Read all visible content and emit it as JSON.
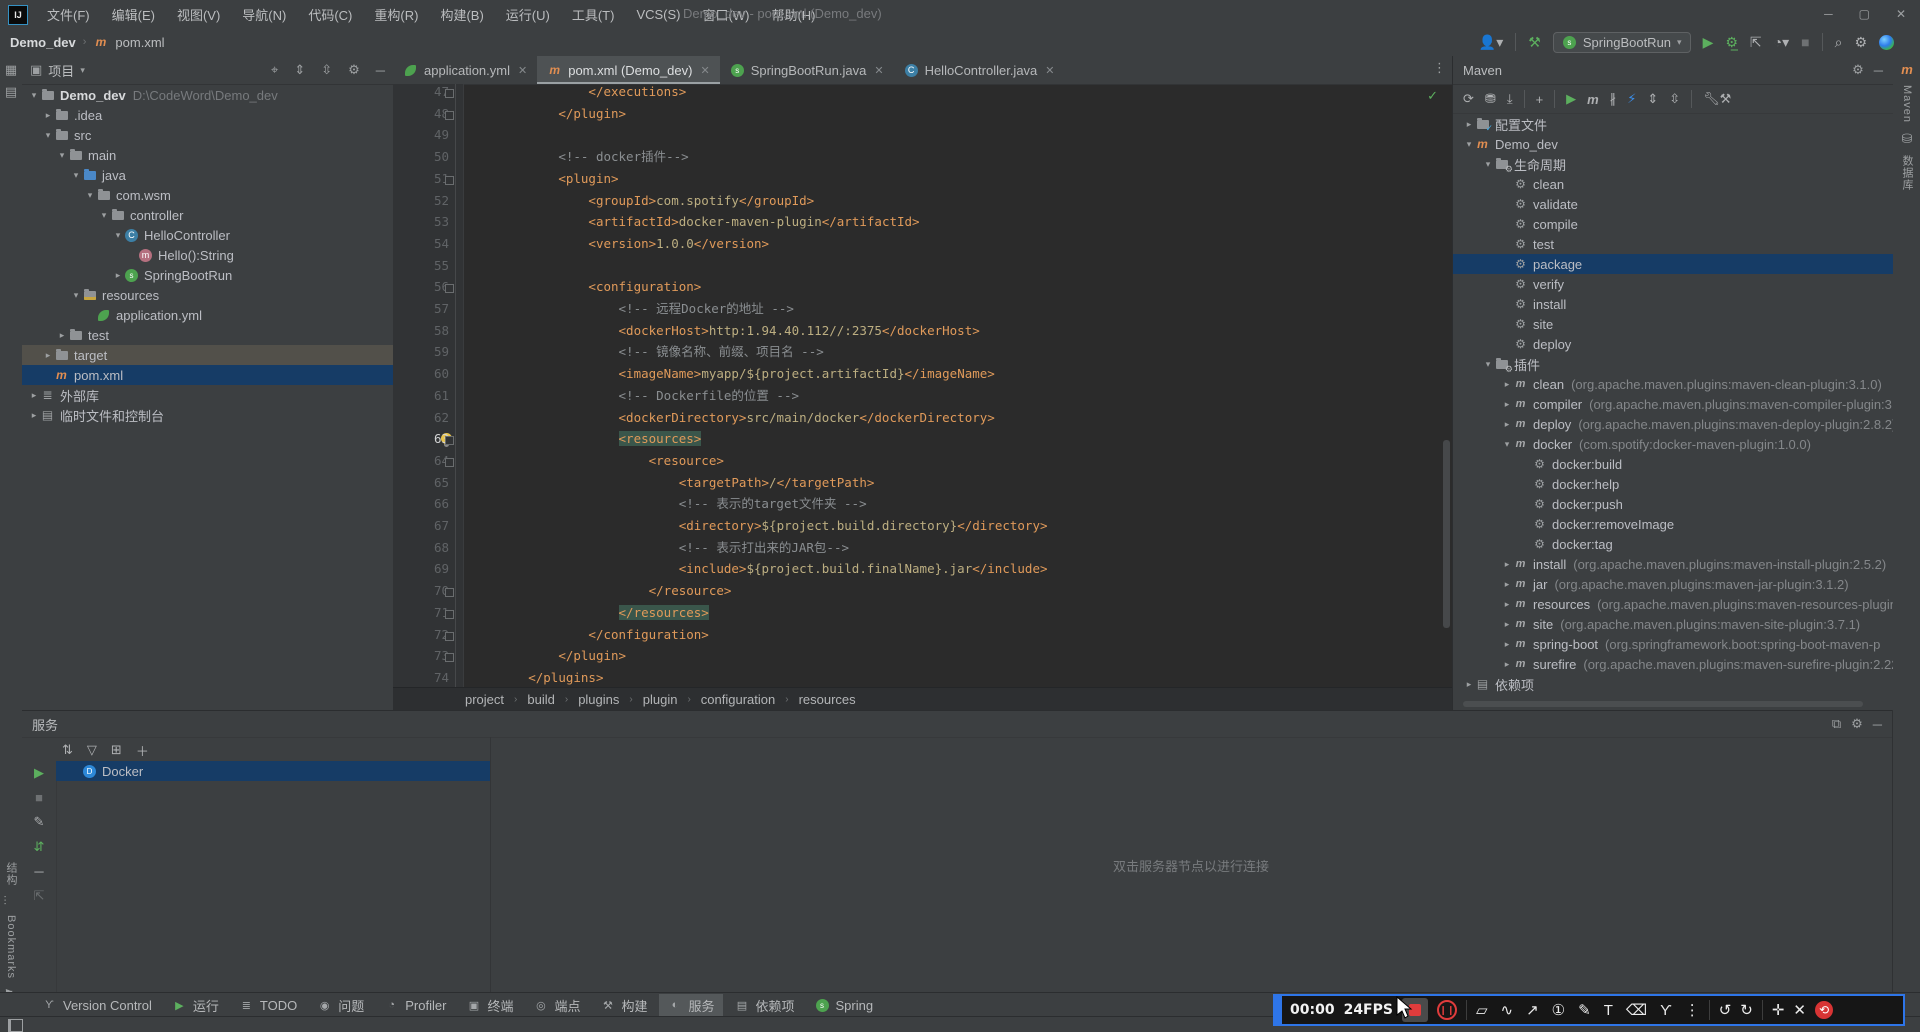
{
  "window": {
    "logo": "IJ",
    "title": "Demo_dev - pom.xml (Demo_dev)",
    "menus": [
      "文件(F)",
      "编辑(E)",
      "视图(V)",
      "导航(N)",
      "代码(C)",
      "重构(R)",
      "构建(B)",
      "运行(U)",
      "工具(T)",
      "VCS(S)",
      "窗口(W)",
      "帮助(H)"
    ],
    "controls": [
      "─",
      "▢",
      "✕"
    ]
  },
  "navbar": {
    "breadcrumb": [
      "Demo_dev",
      "pom.xml"
    ],
    "run_config": "SpringBootRun"
  },
  "tabs": [
    {
      "label": "application.yml",
      "icon": "yml",
      "active": false
    },
    {
      "label": "pom.xml (Demo_dev)",
      "icon": "m",
      "active": true
    },
    {
      "label": "SpringBootRun.java",
      "icon": "spring",
      "active": false
    },
    {
      "label": "HelloController.java",
      "icon": "class",
      "active": false
    }
  ],
  "project": {
    "title": "项目",
    "tree": [
      {
        "d": 0,
        "chev": "v",
        "icon": "folder",
        "label": "Demo_dev",
        "bold": true,
        "extra": "D:\\CodeWord\\Demo_dev",
        "sel": ""
      },
      {
        "d": 1,
        "chev": ">",
        "icon": "folder",
        "label": ".idea",
        "sel": ""
      },
      {
        "d": 1,
        "chev": "v",
        "icon": "folder",
        "label": "src",
        "sel": ""
      },
      {
        "d": 2,
        "chev": "v",
        "icon": "folder",
        "label": "main",
        "sel": ""
      },
      {
        "d": 3,
        "chev": "v",
        "icon": "folder-blue",
        "label": "java",
        "sel": ""
      },
      {
        "d": 4,
        "chev": "v",
        "icon": "folder",
        "label": "com.wsm",
        "sel": ""
      },
      {
        "d": 5,
        "chev": "v",
        "icon": "folder",
        "label": "controller",
        "sel": ""
      },
      {
        "d": 6,
        "chev": "v",
        "icon": "class",
        "label": "HelloController",
        "sel": ""
      },
      {
        "d": 7,
        "chev": "",
        "icon": "method",
        "label": "Hello():String",
        "sel": ""
      },
      {
        "d": 6,
        "chev": ">",
        "icon": "spring",
        "label": "SpringBootRun",
        "sel": ""
      },
      {
        "d": 3,
        "chev": "v",
        "icon": "folder-res",
        "label": "resources",
        "sel": ""
      },
      {
        "d": 4,
        "chev": "",
        "icon": "yml",
        "label": "application.yml",
        "sel": ""
      },
      {
        "d": 2,
        "chev": ">",
        "icon": "folder",
        "label": "test",
        "sel": ""
      },
      {
        "d": 1,
        "chev": ">",
        "icon": "folder",
        "label": "target",
        "sel": "gray"
      },
      {
        "d": 1,
        "chev": "",
        "icon": "m",
        "label": "pom.xml",
        "sel": "blue"
      },
      {
        "d": 0,
        "chev": ">",
        "icon": "lib",
        "label": "外部库",
        "sel": ""
      },
      {
        "d": 0,
        "chev": ">",
        "icon": "console",
        "label": "临时文件和控制台",
        "sel": ""
      }
    ]
  },
  "editor": {
    "current_line": 63,
    "fold_lines": [
      47,
      48,
      51,
      56,
      63,
      64,
      70,
      71,
      72,
      73
    ],
    "lines": [
      {
        "n": 47,
        "t": "                </executions>"
      },
      {
        "n": 48,
        "t": "            </plugin>"
      },
      {
        "n": 49,
        "t": ""
      },
      {
        "n": 50,
        "t": "            <!-- docker插件-->"
      },
      {
        "n": 51,
        "t": "            <plugin>"
      },
      {
        "n": 52,
        "t": "                <groupId>com.spotify</groupId>"
      },
      {
        "n": 53,
        "t": "                <artifactId>docker-maven-plugin</artifactId>"
      },
      {
        "n": 54,
        "t": "                <version>1.0.0</version>"
      },
      {
        "n": 55,
        "t": ""
      },
      {
        "n": 56,
        "t": "                <configuration>"
      },
      {
        "n": 57,
        "t": "                    <!-- 远程Docker的地址 -->"
      },
      {
        "n": 58,
        "t": "                    <dockerHost>http:1.94.40.112//:2375</dockerHost>"
      },
      {
        "n": 59,
        "t": "                    <!-- 镜像名称、前缀、项目名 -->"
      },
      {
        "n": 60,
        "t": "                    <imageName>myapp/${project.artifactId}</imageName>"
      },
      {
        "n": 61,
        "t": "                    <!-- Dockerfile的位置 -->"
      },
      {
        "n": 62,
        "t": "                    <dockerDirectory>src/main/docker</dockerDirectory>"
      },
      {
        "n": 63,
        "t": "                    <resources>",
        "hl": true
      },
      {
        "n": 64,
        "t": "                        <resource>"
      },
      {
        "n": 65,
        "t": "                            <targetPath>/</targetPath>"
      },
      {
        "n": 66,
        "t": "                            <!-- 表示的target文件夹 -->"
      },
      {
        "n": 67,
        "t": "                            <directory>${project.build.directory}</directory>"
      },
      {
        "n": 68,
        "t": "                            <!-- 表示打出来的JAR包-->"
      },
      {
        "n": 69,
        "t": "                            <include>${project.build.finalName}.jar</include>"
      },
      {
        "n": 70,
        "t": "                        </resource>"
      },
      {
        "n": 71,
        "t": "                    </resources>",
        "hl": true
      },
      {
        "n": 72,
        "t": "                </configuration>"
      },
      {
        "n": 73,
        "t": "            </plugin>"
      },
      {
        "n": 74,
        "t": "        </plugins>"
      }
    ],
    "breadcrumbs": [
      "project",
      "build",
      "plugins",
      "plugin",
      "configuration",
      "resources"
    ]
  },
  "maven": {
    "title": "Maven",
    "tree": [
      {
        "d": 0,
        "chev": ">",
        "icon": "folder-check",
        "label": "配置文件",
        "extra": "",
        "sel": ""
      },
      {
        "d": 0,
        "chev": "v",
        "icon": "m",
        "label": "Demo_dev",
        "extra": "",
        "sel": ""
      },
      {
        "d": 1,
        "chev": "v",
        "icon": "folder-gear",
        "label": "生命周期",
        "extra": "",
        "sel": ""
      },
      {
        "d": 2,
        "chev": "",
        "icon": "goal",
        "label": "clean",
        "extra": "",
        "sel": ""
      },
      {
        "d": 2,
        "chev": "",
        "icon": "goal",
        "label": "validate",
        "extra": "",
        "sel": ""
      },
      {
        "d": 2,
        "chev": "",
        "icon": "goal",
        "label": "compile",
        "extra": "",
        "sel": ""
      },
      {
        "d": 2,
        "chev": "",
        "icon": "goal",
        "label": "test",
        "extra": "",
        "sel": ""
      },
      {
        "d": 2,
        "chev": "",
        "icon": "goal",
        "label": "package",
        "extra": "",
        "sel": "blue"
      },
      {
        "d": 2,
        "chev": "",
        "icon": "goal",
        "label": "verify",
        "extra": "",
        "sel": ""
      },
      {
        "d": 2,
        "chev": "",
        "icon": "goal",
        "label": "install",
        "extra": "",
        "sel": ""
      },
      {
        "d": 2,
        "chev": "",
        "icon": "goal",
        "label": "site",
        "extra": "",
        "sel": ""
      },
      {
        "d": 2,
        "chev": "",
        "icon": "goal",
        "label": "deploy",
        "extra": "",
        "sel": ""
      },
      {
        "d": 1,
        "chev": "v",
        "icon": "folder-gear",
        "label": "插件",
        "extra": "",
        "sel": ""
      },
      {
        "d": 2,
        "chev": ">",
        "icon": "mgray",
        "label": "clean",
        "extra": "(org.apache.maven.plugins:maven-clean-plugin:3.1.0)",
        "sel": ""
      },
      {
        "d": 2,
        "chev": ">",
        "icon": "mgray",
        "label": "compiler",
        "extra": "(org.apache.maven.plugins:maven-compiler-plugin:3.",
        "sel": ""
      },
      {
        "d": 2,
        "chev": ">",
        "icon": "mgray",
        "label": "deploy",
        "extra": "(org.apache.maven.plugins:maven-deploy-plugin:2.8.2)",
        "sel": ""
      },
      {
        "d": 2,
        "chev": "v",
        "icon": "mgray",
        "label": "docker",
        "extra": "(com.spotify:docker-maven-plugin:1.0.0)",
        "sel": ""
      },
      {
        "d": 3,
        "chev": "",
        "icon": "goal",
        "label": "docker:build",
        "extra": "",
        "sel": ""
      },
      {
        "d": 3,
        "chev": "",
        "icon": "goal",
        "label": "docker:help",
        "extra": "",
        "sel": ""
      },
      {
        "d": 3,
        "chev": "",
        "icon": "goal",
        "label": "docker:push",
        "extra": "",
        "sel": ""
      },
      {
        "d": 3,
        "chev": "",
        "icon": "goal",
        "label": "docker:removeImage",
        "extra": "",
        "sel": ""
      },
      {
        "d": 3,
        "chev": "",
        "icon": "goal",
        "label": "docker:tag",
        "extra": "",
        "sel": ""
      },
      {
        "d": 2,
        "chev": ">",
        "icon": "mgray",
        "label": "install",
        "extra": "(org.apache.maven.plugins:maven-install-plugin:2.5.2)",
        "sel": ""
      },
      {
        "d": 2,
        "chev": ">",
        "icon": "mgray",
        "label": "jar",
        "extra": "(org.apache.maven.plugins:maven-jar-plugin:3.1.2)",
        "sel": ""
      },
      {
        "d": 2,
        "chev": ">",
        "icon": "mgray",
        "label": "resources",
        "extra": "(org.apache.maven.plugins:maven-resources-plugin:",
        "sel": ""
      },
      {
        "d": 2,
        "chev": ">",
        "icon": "mgray",
        "label": "site",
        "extra": "(org.apache.maven.plugins:maven-site-plugin:3.7.1)",
        "sel": ""
      },
      {
        "d": 2,
        "chev": ">",
        "icon": "mgray",
        "label": "spring-boot",
        "extra": "(org.springframework.boot:spring-boot-maven-p",
        "sel": ""
      },
      {
        "d": 2,
        "chev": ">",
        "icon": "mgray",
        "label": "surefire",
        "extra": "(org.apache.maven.plugins:maven-surefire-plugin:2.22",
        "sel": ""
      },
      {
        "d": 0,
        "chev": ">",
        "icon": "deps",
        "label": "依赖项",
        "extra": "",
        "sel": ""
      }
    ]
  },
  "services": {
    "title": "服务",
    "rows": [
      {
        "icon": "docker",
        "label": "Docker",
        "sel": "blue"
      }
    ],
    "hint": "双击服务器节点以进行连接"
  },
  "bottombar": [
    {
      "icon": "branch",
      "label": "Version Control",
      "active": false
    },
    {
      "icon": "play",
      "label": "运行",
      "active": false
    },
    {
      "icon": "todo",
      "label": "TODO",
      "active": false
    },
    {
      "icon": "issue",
      "label": "问题",
      "active": false
    },
    {
      "icon": "profiler",
      "label": "Profiler",
      "active": false
    },
    {
      "icon": "terminal",
      "label": "终端",
      "active": false
    },
    {
      "icon": "endpoints",
      "label": "端点",
      "active": false
    },
    {
      "icon": "build",
      "label": "构建",
      "active": false
    },
    {
      "icon": "services",
      "label": "服务",
      "active": true
    },
    {
      "icon": "deps",
      "label": "依赖项",
      "active": false
    },
    {
      "icon": "spring",
      "label": "Spring",
      "active": false
    }
  ],
  "stripes": {
    "left_bottom": [
      {
        "label": "结构",
        "icon": "structure"
      },
      {
        "label": "Bookmarks",
        "icon": "bookmark"
      }
    ],
    "right": [
      {
        "label": "Maven",
        "icon": "maven"
      },
      {
        "label": "数据库",
        "icon": "database"
      }
    ]
  },
  "recorder": {
    "time": "00:00",
    "fps": "24FPS",
    "tools": [
      {
        "name": "shapes-tool",
        "glyph": "▱"
      },
      {
        "name": "freehand-pen-tool",
        "glyph": "∿"
      },
      {
        "name": "arrow-tool",
        "glyph": "↗"
      },
      {
        "name": "step-number-tool",
        "glyph": "①"
      },
      {
        "name": "pencil-tool",
        "glyph": "✎"
      },
      {
        "name": "text-tool",
        "glyph": "T"
      },
      {
        "name": "eraser-tool",
        "glyph": "⌫"
      },
      {
        "name": "spotlight-tool",
        "glyph": "ϒ"
      },
      {
        "name": "more-tools",
        "glyph": "⋮"
      }
    ],
    "undo": "↺",
    "redo": "↻",
    "move": "✛",
    "close": "✕",
    "logo": "⟲"
  },
  "colors": {
    "selection_blue": "#163c66",
    "selection_gray": "#52504a",
    "recorder_accent": "#2e75e8",
    "tag_orange": "#e09a5a",
    "run_green": "#5caf5e"
  }
}
